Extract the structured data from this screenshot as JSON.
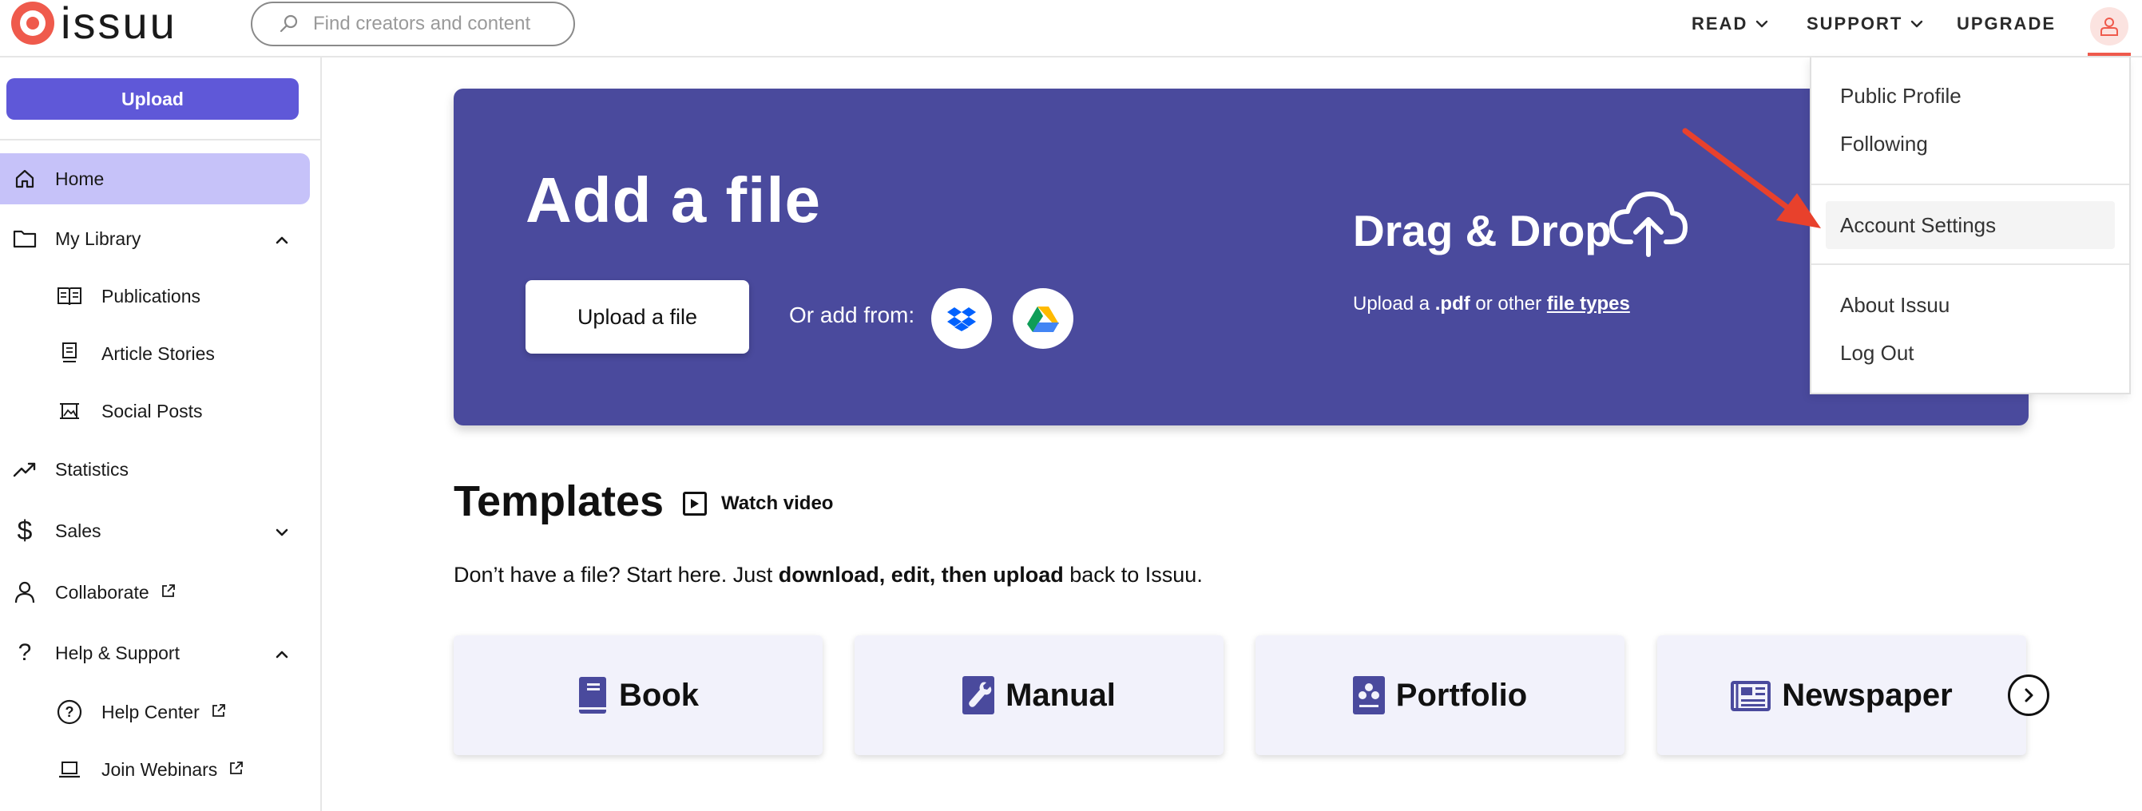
{
  "header": {
    "logo_text": "issuu",
    "search_placeholder": "Find creators and content",
    "nav": [
      {
        "label": "READ"
      },
      {
        "label": "SUPPORT"
      },
      {
        "label": "UPGRADE"
      }
    ]
  },
  "sidebar": {
    "upload_label": "Upload",
    "items": [
      {
        "label": "Home",
        "icon": "home-icon",
        "active": true
      },
      {
        "label": "My Library",
        "icon": "folder-icon",
        "expanded": true
      },
      {
        "label": "Publications",
        "icon": "book-open-icon"
      },
      {
        "label": "Article Stories",
        "icon": "article-icon"
      },
      {
        "label": "Social Posts",
        "icon": "image-frame-icon"
      },
      {
        "label": "Statistics",
        "icon": "trend-icon"
      },
      {
        "label": "Sales",
        "icon": "dollar-icon",
        "expanded": false
      },
      {
        "label": "Collaborate",
        "icon": "person-icon",
        "external": true
      },
      {
        "label": "Help & Support",
        "icon": "question-icon",
        "expanded": true
      },
      {
        "label": "Help Center",
        "icon": "help-circle-icon",
        "external": true
      },
      {
        "label": "Join Webinars",
        "icon": "laptop-icon",
        "external": true
      }
    ]
  },
  "hero": {
    "title": "Add a file",
    "upload_button": "Upload a file",
    "or_add_from": "Or add from:",
    "drag_drop_title": "Drag & Drop",
    "sub_prefix": "Upload a",
    "sub_pdf": ".pdf",
    "sub_middle": "or other",
    "sub_link": "file types",
    "colors": {
      "background": "#4a4a9d",
      "primary_button": "#5f58d8",
      "brand": "#ef5a4c"
    }
  },
  "templates": {
    "title": "Templates",
    "watch_video": "Watch video",
    "desc_prefix": "Don’t have a file? Start here. Just",
    "desc_bold": "download, edit, then upload",
    "desc_suffix": "back to Issuu.",
    "cards": [
      {
        "label": "Book",
        "icon": "book-icon"
      },
      {
        "label": "Manual",
        "icon": "wrench-icon"
      },
      {
        "label": "Portfolio",
        "icon": "portfolio-icon"
      },
      {
        "label": "Newspaper",
        "icon": "newspaper-icon"
      }
    ]
  },
  "account_menu": {
    "items": [
      {
        "label": "Public Profile"
      },
      {
        "label": "Following"
      },
      {
        "label": "Account Settings",
        "highlighted": true
      },
      {
        "label": "About Issuu"
      },
      {
        "label": "Log Out"
      }
    ]
  }
}
